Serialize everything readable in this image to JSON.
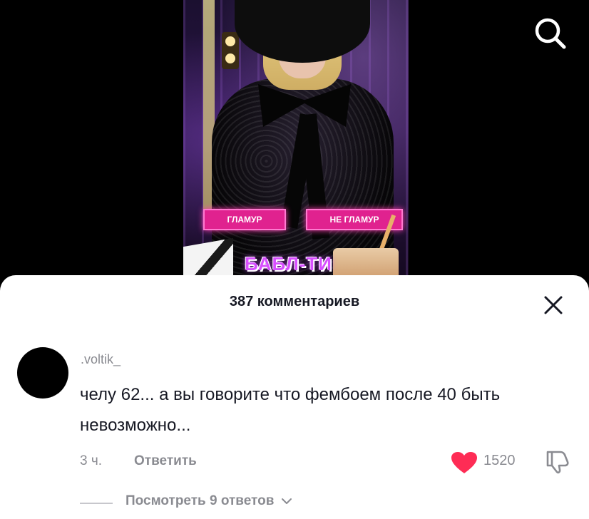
{
  "video": {
    "tag_left": "ГЛАМУР",
    "tag_right": "НЕ ГЛАМУР",
    "caption": "БАБЛ-ТИ"
  },
  "header": {
    "search_icon": "search-icon"
  },
  "comments": {
    "title": "387 комментариев",
    "close_icon": "close-icon",
    "items": [
      {
        "username": ".voltik_",
        "text": "челу 62... а вы говорите что фембоем после 40 быть невозможно...",
        "time": "3 ч.",
        "reply_label": "Ответить",
        "likes": "1520",
        "liked": true,
        "view_replies": "Посмотреть 9 ответов"
      }
    ]
  },
  "colors": {
    "accent_like": "#fe2c55",
    "text_primary": "#161823",
    "text_secondary": "#8a8b91",
    "tag_pink": "#e0228f"
  }
}
